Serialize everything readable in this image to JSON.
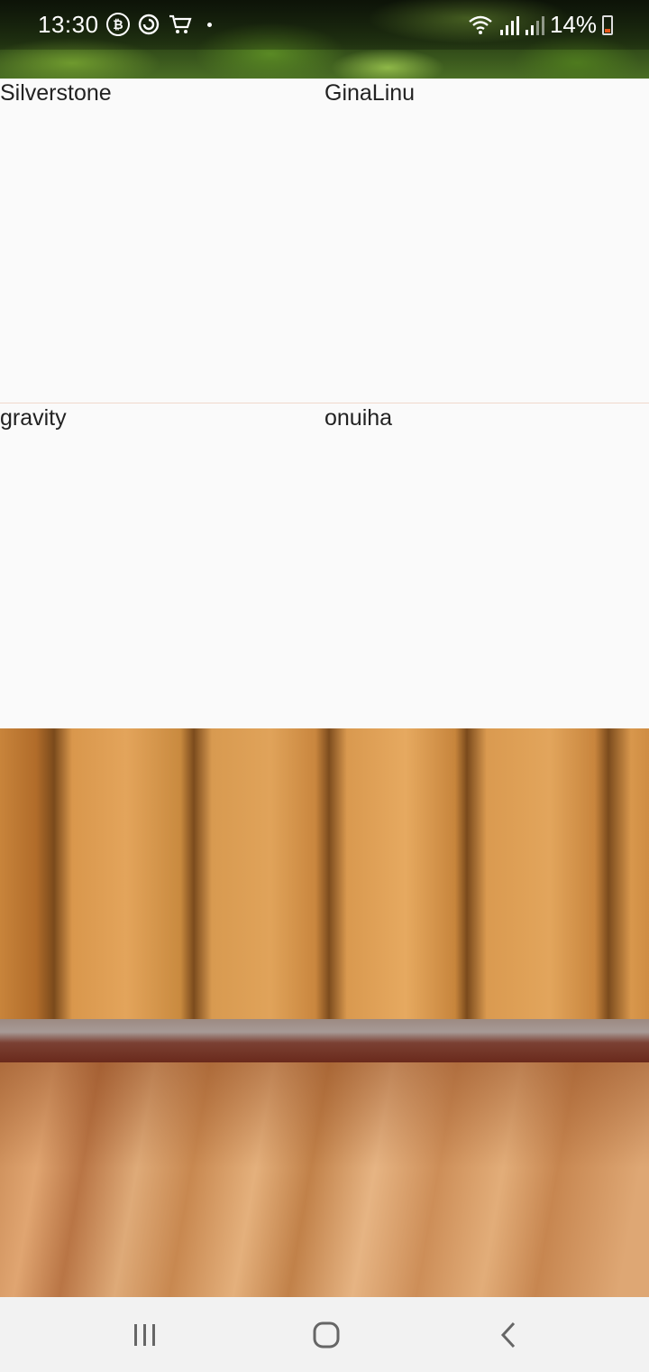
{
  "status_bar": {
    "time": "13:30",
    "notification_icons": [
      "bitcoin-icon",
      "sync-icon",
      "cart-icon"
    ],
    "battery_percent": "14%",
    "battery_level": 0.14,
    "colors": {
      "battery_low": "#e8591c"
    }
  },
  "grid": {
    "cells": [
      {
        "label": "Silverstone"
      },
      {
        "label": "GinaLinu"
      },
      {
        "label": "gravity"
      },
      {
        "label": "onuiha"
      }
    ]
  },
  "nav_bar": {
    "buttons": [
      "recent-apps-icon",
      "home-icon",
      "back-icon"
    ]
  }
}
